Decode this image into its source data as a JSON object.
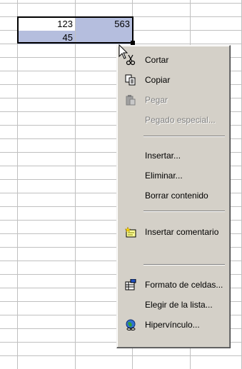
{
  "cells": {
    "a1": "123",
    "b1": "563",
    "a2": "45",
    "b2": ""
  },
  "colors": {
    "selection": "#b5bede",
    "menu_bg": "#d4d0c8",
    "disabled": "#808080"
  },
  "context_menu": {
    "cut": "Cortar",
    "copy": "Copiar",
    "paste": "Pegar",
    "paste_special": "Pegado especial...",
    "insert": "Insertar...",
    "delete": "Eliminar...",
    "clear_contents": "Borrar contenido",
    "insert_comment": "Insertar comentario",
    "format_cells": "Formato de celdas...",
    "pick_from_list": "Elegir de la lista...",
    "hyperlink": "Hipervínculo..."
  },
  "icons": {
    "cut": "scissors-icon",
    "copy": "copy-icon",
    "paste": "paste-icon",
    "insert_comment": "comment-icon",
    "format_cells": "format-cells-icon",
    "hyperlink": "hyperlink-icon"
  }
}
